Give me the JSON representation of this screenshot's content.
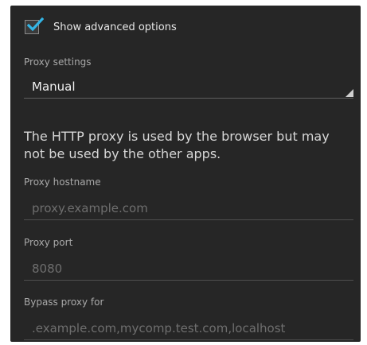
{
  "advanced": {
    "label": "Show advanced options",
    "checked": true,
    "accent_color": "#33b5e5"
  },
  "proxy_settings": {
    "label": "Proxy settings",
    "selected": "Manual"
  },
  "info_text": "The HTTP proxy is used by the browser but may not be used by the other apps.",
  "hostname": {
    "label": "Proxy hostname",
    "value": "",
    "placeholder": "proxy.example.com"
  },
  "port": {
    "label": "Proxy port",
    "value": "",
    "placeholder": "8080"
  },
  "bypass": {
    "label": "Bypass proxy for",
    "value": "",
    "placeholder": ".example.com,mycomp.test.com,localhost"
  }
}
